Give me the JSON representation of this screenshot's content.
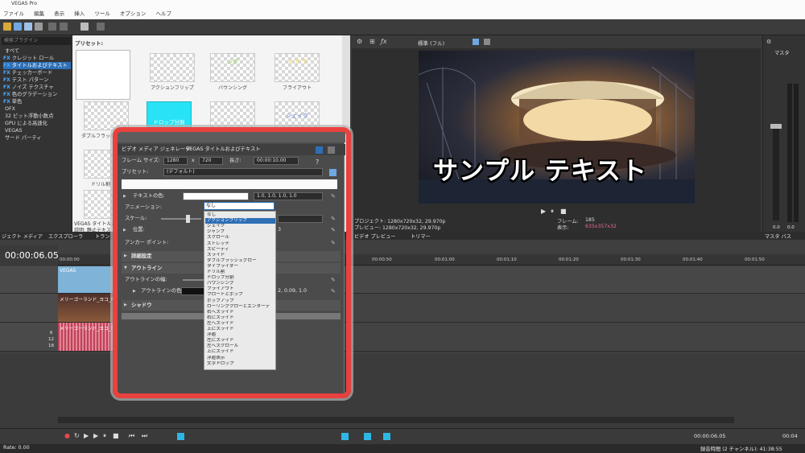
{
  "window": {
    "title": "VEGAS Pro"
  },
  "menu": [
    "ファイル",
    "編集",
    "表示",
    "挿入",
    "ツール",
    "オプション",
    "ヘルプ"
  ],
  "fx_panel": {
    "search_placeholder": "検索プラグイン",
    "items": [
      {
        "fx": "",
        "label": "すべて"
      },
      {
        "fx": "FX",
        "label": "クレジット ロール"
      },
      {
        "fx": "FX",
        "label": "タイトルおよびテキスト"
      },
      {
        "fx": "FX",
        "label": "チェッカーボード"
      },
      {
        "fx": "FX",
        "label": "テスト パターン"
      },
      {
        "fx": "FX",
        "label": "ノイズ テクスチャ"
      },
      {
        "fx": "FX",
        "label": "色のグラデーション"
      },
      {
        "fx": "FX",
        "label": "単色"
      },
      {
        "fx": "",
        "label": "OFX"
      },
      {
        "fx": "",
        "label": "32 ビット浮動小数点"
      },
      {
        "fx": "",
        "label": "GPU による高速化"
      },
      {
        "fx": "",
        "label": "VEGAS"
      },
      {
        "fx": "",
        "label": "サード パーティ"
      }
    ]
  },
  "presets": {
    "label": "プリセット:",
    "items": [
      {
        "name": "",
        "text": ""
      },
      {
        "name": "アクションフリップ",
        "text": ""
      },
      {
        "name": "バウンシング",
        "text": "ング"
      },
      {
        "name": "フライアウト",
        "text": "イ ア ウ"
      },
      {
        "name": "ダブルフラッシュ",
        "text": ""
      },
      {
        "name": "ドロップ分割",
        "text": "ドロップ分割"
      },
      {
        "name": "",
        "text": ""
      },
      {
        "name": "",
        "text": "シェイク"
      },
      {
        "name": "ドリル割",
        "text": ""
      }
    ],
    "footer_line1": "VEGAS タイトルお",
    "footer_line2": "説明: 静止テキス"
  },
  "preview": {
    "toolbar_label": "標準 (フル)",
    "overlay_text": "サンプル テキスト",
    "project": "プロジェクト: 1280x720x32, 29.970p",
    "preview": "プレビュー: 1280x720x32, 29.970p",
    "frame_label": "フレーム:",
    "frame_value": "185",
    "display_label": "表示:",
    "display_value": "635x357x32",
    "tab_preview": "ビデオ プレビュー",
    "tab_trimmer": "トリマー"
  },
  "master": {
    "label": "マスタ",
    "bus_label": "マスタ バス",
    "meter_values": [
      "0.0",
      "0.0"
    ]
  },
  "tabs": [
    "ジェクト メディア",
    "エクスプローラ",
    "トラン"
  ],
  "timeline": {
    "time": "00:00:06.05",
    "ruler_start": "00:00:00",
    "ruler": [
      "00:00:50",
      "00:01:00",
      "00:01:10",
      "00:01:20",
      "00:01:30",
      "00:01:40",
      "00:01:50"
    ],
    "clip_title": "VEGAS",
    "clip_video": "メリーゴーランド_ヨコ_MVI_",
    "clip_audio": "メリーゴーランド_ヨコ_MVI_5139",
    "audio_scale": [
      "6",
      "12",
      "18"
    ],
    "end_time": "00:00:06.05",
    "end_time_right": "00:04"
  },
  "status": {
    "rate": "Rate: 0.00",
    "record_time": "録音時間 (2 チャンネル): 41:38:55"
  },
  "generator": {
    "header": "ビデオ メディア ジェネレータ:",
    "header_value": "VEGAS タイトルおよびテキスト",
    "frame_size_label": "フレーム サイズ:",
    "width": "1280",
    "x": "x",
    "height": "720",
    "length_label": "長さ:",
    "length": "00:00:10.00",
    "preset_label": "プリセット:",
    "preset_value": "(デフォルト)",
    "text_color_label": "テキストの色:",
    "text_color_value": "1.0, 1.0, 1.0, 1.0",
    "animation_label": "アニメーション:",
    "animation_value": "なし",
    "scale_label": "スケール:",
    "position_label": "位置:",
    "position_value": "3",
    "anchor_label": "アンカー ポイント:",
    "details": "詳細設定",
    "outline": "アウトライン",
    "outline_width_label": "アウトラインの幅:",
    "outline_color_label": "アウトラインの色:",
    "outline_color_value": "2, 0.09, 1.0",
    "shadow": "シャドウ"
  },
  "animation_options": [
    "なし",
    "アクションフリップ",
    "シェイク",
    "ジャンプ",
    "スクロール",
    "ストレッチ",
    "スピーディ",
    "スライド",
    "ダブルフラッシュグロー",
    "タイプライター",
    "ドリル割",
    "ドロップ分割",
    "バウンシング",
    "フライアウト",
    "フロートとポップ",
    "ポップアップ",
    "ローリングクローとエンターテ",
    "右へスライド",
    "右にスライド",
    "左へスライド",
    "上にスライド",
    "浮遊",
    "左にスライド",
    "左へスクロール",
    "上にスライド",
    "浮遊表示",
    "文字ドロップ"
  ],
  "colors": {
    "accent": "#2e6fb6",
    "highlight_frame": "#e8413e",
    "fx_tag": "#4aa8ff"
  }
}
